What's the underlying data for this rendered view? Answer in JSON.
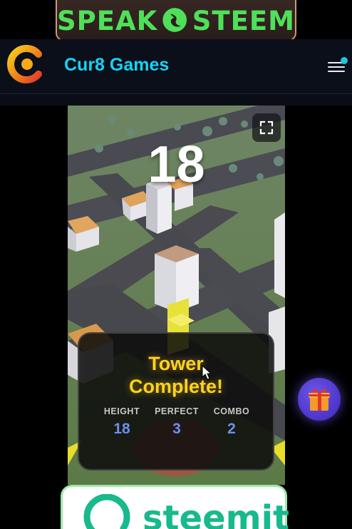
{
  "top_banner": {
    "left_word": "SPEAK",
    "right_word": "STEEM",
    "color": "#4fe05a"
  },
  "header": {
    "site_title": "Cur8 Games",
    "logo_icon": "cur8-logo-icon",
    "menu_icon": "hamburger-menu-icon",
    "accent": "#17d3f2"
  },
  "game": {
    "score": "18",
    "fullscreen_icon": "fullscreen-icon",
    "result": {
      "title_line1": "Tower",
      "title_line2": "Complete!",
      "stats": [
        {
          "label": "HEIGHT",
          "value": "18"
        },
        {
          "label": "PERFECT",
          "value": "3"
        },
        {
          "label": "COMBO",
          "value": "2"
        }
      ]
    }
  },
  "gift_button": {
    "icon": "gift-icon"
  },
  "bottom_banner": {
    "brand": "steemit",
    "color": "#17b98d"
  }
}
